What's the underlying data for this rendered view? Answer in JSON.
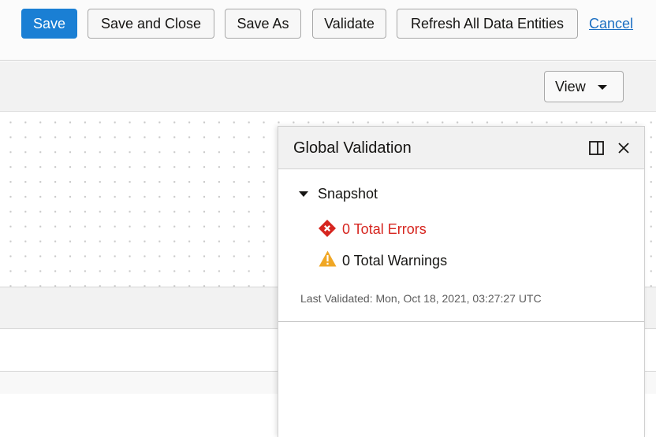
{
  "toolbar": {
    "save_label": "Save",
    "save_close_label": "Save and Close",
    "save_as_label": "Save As",
    "validate_label": "Validate",
    "refresh_label": "Refresh All Data Entities",
    "cancel_label": "Cancel"
  },
  "view_menu": {
    "label": "View",
    "icon": "chevron-down-icon"
  },
  "panel": {
    "title": "Global Validation",
    "dock_icon": "dock-panel-icon",
    "close_icon": "close-icon",
    "snapshot": {
      "label": "Snapshot",
      "expanded": true,
      "errors_text": "0 Total Errors",
      "warnings_text": "0 Total Warnings",
      "last_validated": "Last Validated: Mon, Oct 18, 2021, 03:27:27 UTC"
    }
  },
  "colors": {
    "primary": "#1a7fd4",
    "link": "#1a6ec2",
    "error": "#d6251f",
    "warning": "#f0a725"
  }
}
